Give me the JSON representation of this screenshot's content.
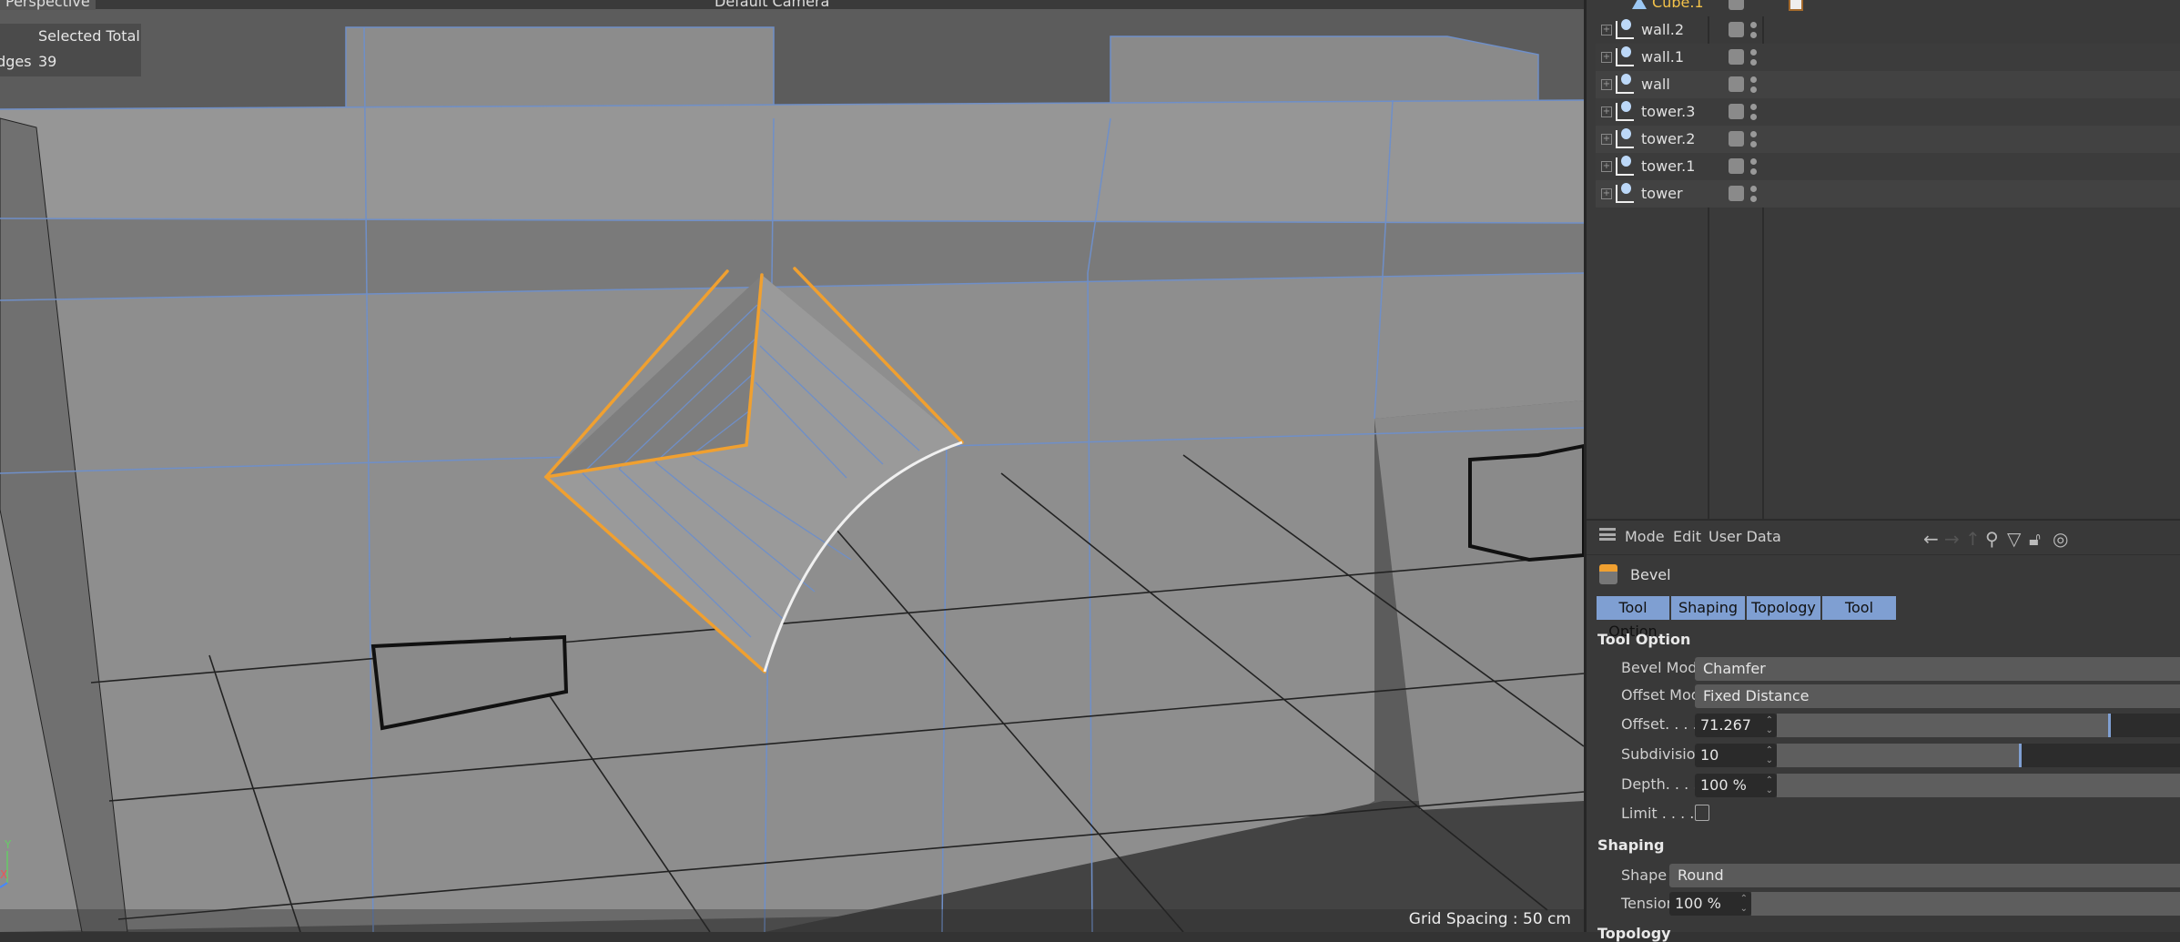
{
  "viewport": {
    "projection_label": "Perspective",
    "camera_label": "Default Camera",
    "hud": {
      "header": "Selected Total",
      "row_label": "Edges",
      "row_value": "39"
    },
    "grid_spacing": "Grid Spacing : 50 cm",
    "axis": {
      "y": "Y",
      "x": "X"
    },
    "colors": {
      "selection": "#f0a030",
      "edge": "#6f8fc8",
      "highlight": "#f0f0f0",
      "surface": "#8e8e8e"
    }
  },
  "object_manager": {
    "items": [
      {
        "name": "Cube.1",
        "color": "#f3c24a",
        "type": "polygon"
      },
      {
        "name": "wall.2",
        "type": "null"
      },
      {
        "name": "wall.1",
        "type": "null"
      },
      {
        "name": "wall",
        "type": "null"
      },
      {
        "name": "tower.3",
        "type": "null"
      },
      {
        "name": "tower.2",
        "type": "null"
      },
      {
        "name": "tower.1",
        "type": "null"
      },
      {
        "name": "tower",
        "type": "null"
      }
    ]
  },
  "attribute_manager": {
    "menu": [
      "Mode",
      "Edit",
      "User Data"
    ],
    "tool_name": "Bevel",
    "tabs": [
      "Tool Option",
      "Shaping",
      "Topology",
      "Tool"
    ],
    "tool_option": {
      "heading": "Tool Option",
      "bevel_mode": {
        "label": "Bevel Mode",
        "value": "Chamfer"
      },
      "offset_mode": {
        "label": "Offset Mode",
        "value": "Fixed Distance"
      },
      "offset": {
        "label": "Offset. . . .",
        "value": "71.267 cm",
        "slider_fraction": 0.82
      },
      "subdivision": {
        "label": "Subdivision",
        "value": "10",
        "slider_fraction": 0.6
      },
      "depth": {
        "label": "Depth. . . .",
        "value": "100 %",
        "slider_fraction": 1.0
      },
      "limit": {
        "label": "Limit . . . .",
        "checked": false
      }
    },
    "shaping": {
      "heading": "Shaping",
      "shape": {
        "label": "Shape",
        "value": "Round"
      },
      "tension": {
        "label": "Tension",
        "value": "100 %"
      }
    },
    "next_heading": "Topology"
  }
}
